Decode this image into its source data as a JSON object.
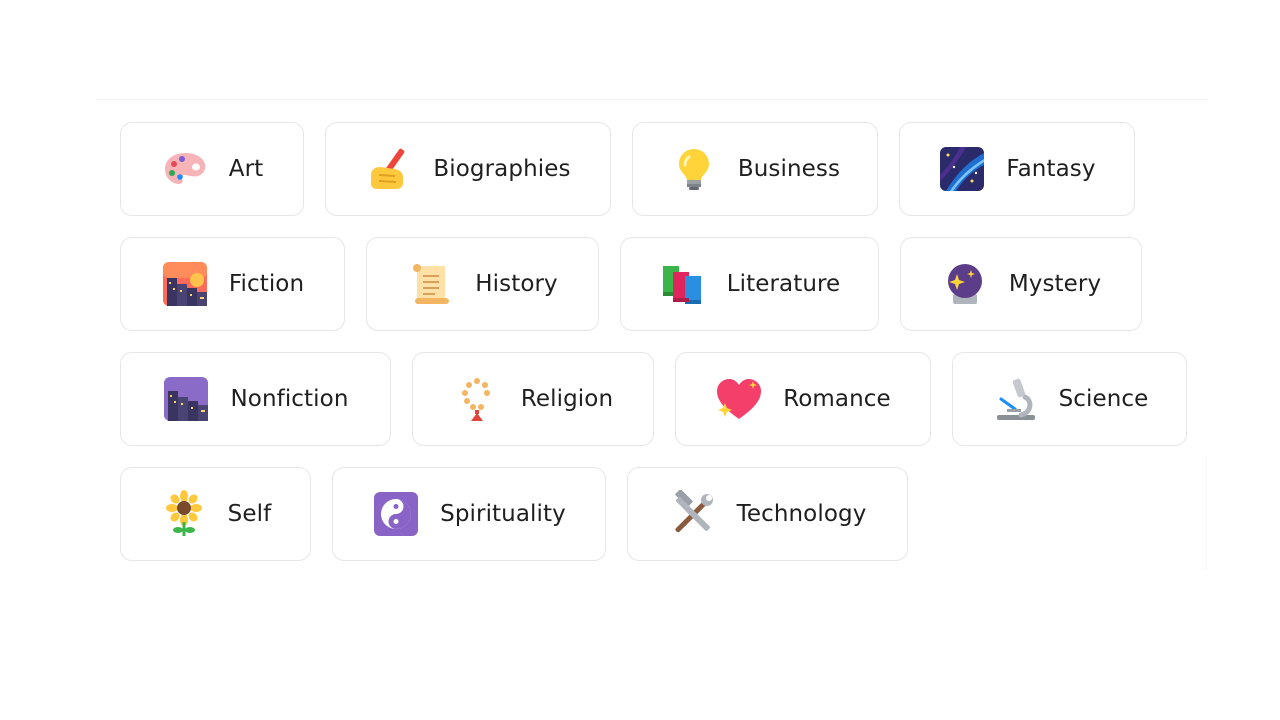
{
  "categories": [
    {
      "label": "Art",
      "icon": "artist-palette-icon"
    },
    {
      "label": "Biographies",
      "icon": "writing-hand-icon"
    },
    {
      "label": "Business",
      "icon": "light-bulb-icon"
    },
    {
      "label": "Fantasy",
      "icon": "milky-way-icon"
    },
    {
      "label": "Fiction",
      "icon": "city-sunset-icon"
    },
    {
      "label": "History",
      "icon": "scroll-icon"
    },
    {
      "label": "Literature",
      "icon": "books-icon"
    },
    {
      "label": "Mystery",
      "icon": "crystal-ball-icon"
    },
    {
      "label": "Nonfiction",
      "icon": "cityscape-dusk-icon"
    },
    {
      "label": "Religion",
      "icon": "prayer-beads-icon"
    },
    {
      "label": "Romance",
      "icon": "sparkling-heart-icon"
    },
    {
      "label": "Science",
      "icon": "microscope-icon"
    },
    {
      "label": "Self",
      "icon": "sunflower-icon"
    },
    {
      "label": "Spirituality",
      "icon": "yin-yang-icon"
    },
    {
      "label": "Technology",
      "icon": "hammer-and-wrench-icon"
    }
  ]
}
